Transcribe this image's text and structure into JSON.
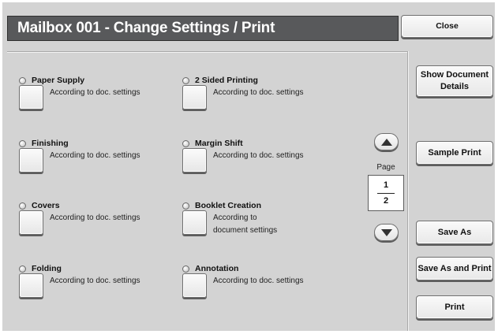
{
  "header": {
    "title": "Mailbox 001 - Change Settings / Print",
    "close_label": "Close"
  },
  "settings": [
    {
      "label": "Paper Supply",
      "value": "According to doc. settings"
    },
    {
      "label": "Finishing",
      "value": "According to doc. settings"
    },
    {
      "label": "Covers",
      "value": "According to doc. settings"
    },
    {
      "label": "Folding",
      "value": "According to doc. settings"
    },
    {
      "label": "2 Sided Printing",
      "value": "According to doc. settings"
    },
    {
      "label": "Margin Shift",
      "value": "According to doc. settings"
    },
    {
      "label": "Booklet Creation",
      "value_line1": "According to",
      "value_line2": "document settings"
    },
    {
      "label": "Annotation",
      "value": "According to doc. settings"
    }
  ],
  "pager": {
    "label": "Page",
    "current": "1",
    "total": "2"
  },
  "side_buttons": {
    "show_details_line1": "Show Document",
    "show_details_line2": "Details",
    "sample_print": "Sample Print",
    "save_as": "Save As",
    "save_as_and_print": "Save As and Print",
    "print": "Print"
  }
}
